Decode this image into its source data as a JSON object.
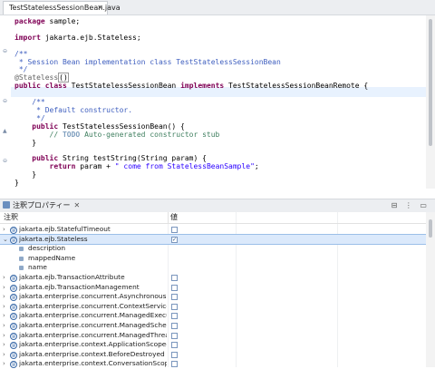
{
  "editor": {
    "tab_title": "TestStatelessSessionBean.java",
    "tab_close": "✕",
    "lines": [
      {
        "tokens": [
          {
            "t": "package",
            "c": "kw"
          },
          {
            "t": " sample;"
          }
        ]
      },
      {
        "tokens": []
      },
      {
        "tokens": [
          {
            "t": "import",
            "c": "kw"
          },
          {
            "t": " jakarta.ejb.Stateless;"
          }
        ]
      },
      {
        "tokens": []
      },
      {
        "tokens": [
          {
            "t": "/**",
            "c": "cm"
          }
        ]
      },
      {
        "tokens": [
          {
            "t": " * Session Bean implementation class TestStatelessSessionBean",
            "c": "cm"
          }
        ]
      },
      {
        "tokens": [
          {
            "t": " */",
            "c": "cm"
          }
        ]
      },
      {
        "tokens": [
          {
            "t": "@Stateless",
            "c": "ann"
          },
          {
            "t": "()",
            "c": "cursor-box"
          }
        ]
      },
      {
        "tokens": [
          {
            "t": "public",
            "c": "kw"
          },
          {
            "t": " "
          },
          {
            "t": "class",
            "c": "kw"
          },
          {
            "t": " TestStatelessSessionBean "
          },
          {
            "t": "implements",
            "c": "kw"
          },
          {
            "t": " TestStatelessSessionBeanRemote {"
          }
        ]
      },
      {
        "tokens": []
      },
      {
        "tokens": [
          {
            "t": "    /**",
            "c": "cm"
          }
        ]
      },
      {
        "tokens": [
          {
            "t": "     * Default constructor.",
            "c": "cm"
          }
        ]
      },
      {
        "tokens": [
          {
            "t": "     */",
            "c": "cm"
          }
        ]
      },
      {
        "tokens": [
          {
            "t": "    "
          },
          {
            "t": "public",
            "c": "kw"
          },
          {
            "t": " TestStatelessSessionBean() {"
          }
        ]
      },
      {
        "tokens": [
          {
            "t": "        // ",
            "c": "lcm"
          },
          {
            "t": "TODO",
            "c": "todo"
          },
          {
            "t": " Auto-generated constructor stub",
            "c": "lcm"
          }
        ]
      },
      {
        "tokens": [
          {
            "t": "    }"
          }
        ]
      },
      {
        "tokens": []
      },
      {
        "tokens": [
          {
            "t": "    "
          },
          {
            "t": "public",
            "c": "kw"
          },
          {
            "t": " String testString(String param) {"
          }
        ]
      },
      {
        "tokens": [
          {
            "t": "        "
          },
          {
            "t": "return",
            "c": "kw"
          },
          {
            "t": " param + "
          },
          {
            "t": "\" come from StatelessBeanSample\"",
            "c": "str"
          },
          {
            "t": ";"
          }
        ]
      },
      {
        "tokens": [
          {
            "t": "    }"
          }
        ]
      },
      {
        "tokens": [
          {
            "t": "}"
          }
        ]
      }
    ]
  },
  "panel": {
    "tab_title": "注釈プロパティー",
    "tab_close": "✕",
    "tools": "⊟ ⋮ ▭",
    "col_annotation": "注釈",
    "col_value": "値",
    "rows": [
      {
        "label": "jakarta.ejb.StatefulTimeout",
        "twisty": "›",
        "checked": false,
        "child": false
      },
      {
        "label": "jakarta.ejb.Stateless",
        "twisty": "⌄",
        "checked": true,
        "child": false,
        "selected": true
      },
      {
        "label": "description",
        "twisty": "",
        "checked": null,
        "child": true
      },
      {
        "label": "mappedName",
        "twisty": "",
        "checked": null,
        "child": true
      },
      {
        "label": "name",
        "twisty": "",
        "checked": null,
        "child": true
      },
      {
        "label": "jakarta.ejb.TransactionAttribute",
        "twisty": "›",
        "checked": false,
        "child": false
      },
      {
        "label": "jakarta.ejb.TransactionManagement",
        "twisty": "›",
        "checked": false,
        "child": false
      },
      {
        "label": "jakarta.enterprise.concurrent.Asynchronous",
        "twisty": "›",
        "checked": false,
        "child": false
      },
      {
        "label": "jakarta.enterprise.concurrent.ContextServiceDefinition",
        "twisty": "›",
        "checked": false,
        "child": false
      },
      {
        "label": "jakarta.enterprise.concurrent.ManagedExecutorDefinition",
        "twisty": "›",
        "checked": false,
        "child": false
      },
      {
        "label": "jakarta.enterprise.concurrent.ManagedScheduledExecutorDefinition",
        "twisty": "›",
        "checked": false,
        "child": false
      },
      {
        "label": "jakarta.enterprise.concurrent.ManagedThreadFactoryDefinition",
        "twisty": "›",
        "checked": false,
        "child": false
      },
      {
        "label": "jakarta.enterprise.context.ApplicationScoped",
        "twisty": "›",
        "checked": false,
        "child": false
      },
      {
        "label": "jakarta.enterprise.context.BeforeDestroyed",
        "twisty": "›",
        "checked": false,
        "child": false
      },
      {
        "label": "jakarta.enterprise.context.ConversationScoped",
        "twisty": "›",
        "checked": false,
        "child": false
      }
    ]
  }
}
